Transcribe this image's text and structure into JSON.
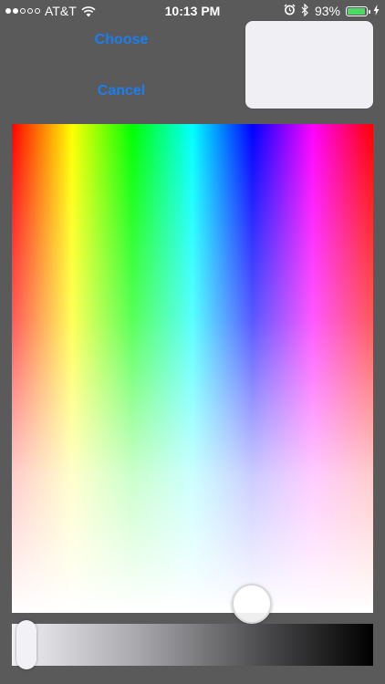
{
  "status_bar": {
    "carrier": "AT&T",
    "time": "10:13 PM",
    "battery_percent": "93%",
    "battery_level": 0.93,
    "signal_bars_filled": 2,
    "signal_bars_total": 5,
    "icons": [
      "signal-dots-icon",
      "wifi-icon",
      "alarm-icon",
      "bluetooth-icon",
      "battery-icon",
      "charging-bolt-icon"
    ],
    "battery_color": "#4cd964"
  },
  "actions": {
    "choose_label": "Choose",
    "cancel_label": "Cancel",
    "accent_color": "#1a7ef2"
  },
  "preview": {
    "color": "#efeff4"
  },
  "picker": {
    "background": "#5a5a5a",
    "brightness_level": 0.0
  }
}
